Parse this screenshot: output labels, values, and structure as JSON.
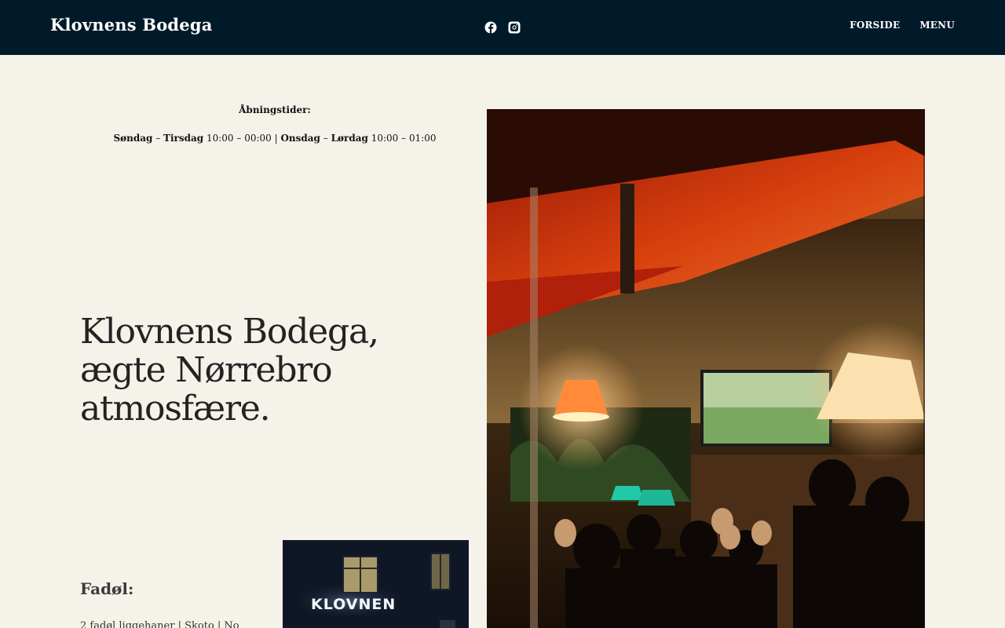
{
  "header": {
    "site_title": "Klovnens Bodega",
    "social": [
      {
        "icon": "facebook-icon"
      },
      {
        "icon": "instagram-icon"
      }
    ],
    "nav": [
      {
        "label": "FORSIDE"
      },
      {
        "label": "MENU"
      }
    ]
  },
  "hours": {
    "title": "Åbningstider:",
    "day1": "Søndag",
    "sep1": " – ",
    "day2": "Tirsdag",
    "time1": " 10:00 – 00:00 | ",
    "day3": "Onsdag",
    "sep2": " – ",
    "day4": "Lørdag",
    "time2": " 10:00 – 01:00"
  },
  "headline": "Klovnens Bodega, ægte Nørrebro atmosfære.",
  "beer": {
    "heading": "Fadøl:",
    "text": "2 fadøl liggehaner | Skoto | No"
  },
  "sign_photo": {
    "sign_text": "KLOVNEN"
  },
  "colors": {
    "header_bg": "#011a2a",
    "page_bg": "#f5f2ea",
    "text": "#1e1e1e"
  }
}
